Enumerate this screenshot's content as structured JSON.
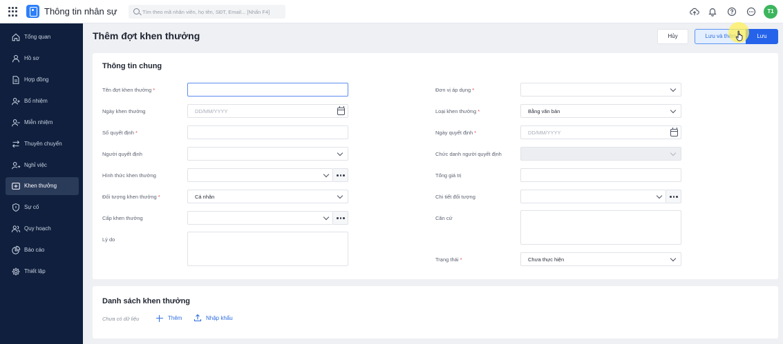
{
  "app": {
    "title": "Thông tin nhân sự",
    "search_placeholder": "Tìm theo mã nhân viên, họ tên, SĐT, Email... [Nhấn F4]",
    "avatar_initials": "T1",
    "brand_color": "#2d7ff9",
    "avatar_color": "#3cb55d",
    "header_icons": [
      "upload-cloud-icon",
      "bell-icon",
      "help-icon",
      "more-icon"
    ]
  },
  "sidebar": {
    "items": [
      {
        "label": "Tổng quan",
        "icon": "home-icon"
      },
      {
        "label": "Hồ sơ",
        "icon": "user-icon"
      },
      {
        "label": "Hợp đồng",
        "icon": "document-icon"
      },
      {
        "label": "Bổ nhiệm",
        "icon": "user-plus-icon"
      },
      {
        "label": "Miễn nhiệm",
        "icon": "user-minus-icon"
      },
      {
        "label": "Thuyên chuyển",
        "icon": "transfer-icon"
      },
      {
        "label": "Nghỉ việc",
        "icon": "user-leave-icon"
      },
      {
        "label": "Khen thưởng",
        "icon": "reward-icon",
        "active": true
      },
      {
        "label": "Sự cố",
        "icon": "shield-icon"
      },
      {
        "label": "Quy hoạch",
        "icon": "users-icon"
      },
      {
        "label": "Báo cáo",
        "icon": "pie-chart-icon"
      },
      {
        "label": "Thiết lập",
        "icon": "gear-icon"
      }
    ]
  },
  "page": {
    "title": "Thêm đợt khen thưởng",
    "buttons": {
      "cancel": "Hủy",
      "save_and_add": "Lưu và thêm",
      "save": "Lưu"
    }
  },
  "general": {
    "title": "Thông tin chung",
    "left": {
      "reward_name": {
        "label": "Tên đợt khen thưởng",
        "required": "*",
        "value": ""
      },
      "reward_date": {
        "label": "Ngày khen thưởng",
        "placeholder": "DD/MM/YYYY"
      },
      "decision_no": {
        "label": "Số quyết định",
        "required": "*",
        "value": ""
      },
      "decider": {
        "label": "Người quyết định",
        "value": ""
      },
      "reward_form": {
        "label": "Hình thức khen thưởng",
        "value": ""
      },
      "target_type": {
        "label": "Đối tượng khen thưởng",
        "required": "*",
        "value": "Cá nhân"
      },
      "reward_level": {
        "label": "Cấp khen thưởng",
        "value": ""
      },
      "reason": {
        "label": "Lý do",
        "value": ""
      }
    },
    "right": {
      "unit": {
        "label": "Đơn vị áp dụng",
        "required": "*",
        "value": ""
      },
      "reward_type": {
        "label": "Loại khen thưởng",
        "required": "*",
        "value": "Bằng văn bản"
      },
      "decision_date": {
        "label": "Ngày quyết định",
        "required": "*",
        "placeholder": "DD/MM/YYYY"
      },
      "decider_title": {
        "label": "Chức danh người quyết định",
        "value": ""
      },
      "total_value": {
        "label": "Tổng giá trị",
        "value": ""
      },
      "target_detail": {
        "label": "Chi tiết đối tượng",
        "value": ""
      },
      "basis": {
        "label": "Căn cứ",
        "value": ""
      },
      "status": {
        "label": "Trạng thái",
        "required": "*",
        "value": "Chưa thực hiện"
      }
    }
  },
  "reward_list": {
    "title": "Danh sách khen thưởng",
    "empty_text": "Chưa có dữ liệu",
    "add_label": "Thêm",
    "import_label": "Nhập khẩu"
  }
}
